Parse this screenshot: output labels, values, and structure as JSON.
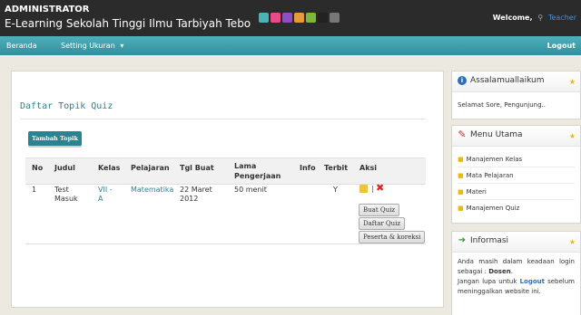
{
  "header": {
    "admin_label": "ADMINISTRATOR",
    "site_title": "E-Learning Sekolah Tinggi Ilmu Tarbiyah Tebo",
    "color_swatches": [
      "#4ab3b9",
      "#e84a8a",
      "#8e4ec6",
      "#e89a3a",
      "#7bb83a",
      "#222222",
      "#777777"
    ],
    "welcome_label": "Welcome,",
    "user_icon": "user-icon",
    "user_name": "Teacher"
  },
  "navbar": {
    "items": [
      {
        "label": "Beranda"
      },
      {
        "label": "Setting Ukuran",
        "icon": "caret-down-icon",
        "caret": "▾"
      }
    ],
    "logout_label": "Logout"
  },
  "main": {
    "title": "Daftar Topik Quiz",
    "add_button": "Tambah Topik",
    "columns": [
      "No",
      "Judul",
      "Kelas",
      "Pelajaran",
      "Tgl Buat",
      "Lama Pengerjaan",
      "Info",
      "Terbit",
      "Aksi"
    ],
    "rows": [
      {
        "no": "1",
        "judul": "Test Masuk",
        "kelas": "VII - A",
        "pelajaran": "Matematika",
        "tgl_buat": "22 Maret 2012",
        "lama": "50 menit",
        "info": "",
        "terbit": "Y",
        "sep": "|",
        "actions": [
          "Buat Quiz",
          "Daftar Quiz",
          "Peserta & koreksi"
        ]
      }
    ]
  },
  "sidebar": {
    "greeting": {
      "title": "Assalamuallaikum",
      "icon": "info-icon",
      "text": "Selamat Sore, Pengunjung.."
    },
    "menu": {
      "title": "Menu Utama",
      "icon": "pencil-icon",
      "items": [
        "Manajemen Kelas",
        "Mata Pelajaran",
        "Materi",
        "Manajemen Quiz"
      ]
    },
    "info": {
      "title": "Informasi",
      "icon": "arrow-right-icon",
      "line1": "Anda masih dalam keadaan login sebagai :",
      "role": "Dosen",
      "line2": "Jangan lupa untuk",
      "logout": "Logout",
      "line3": "sebelum meninggalkan website ini."
    },
    "star": "★"
  },
  "colors": {
    "accent": "#2c8390",
    "nav": "#3fa2ae",
    "star": "#f0b800",
    "delete": "#dd2222"
  }
}
